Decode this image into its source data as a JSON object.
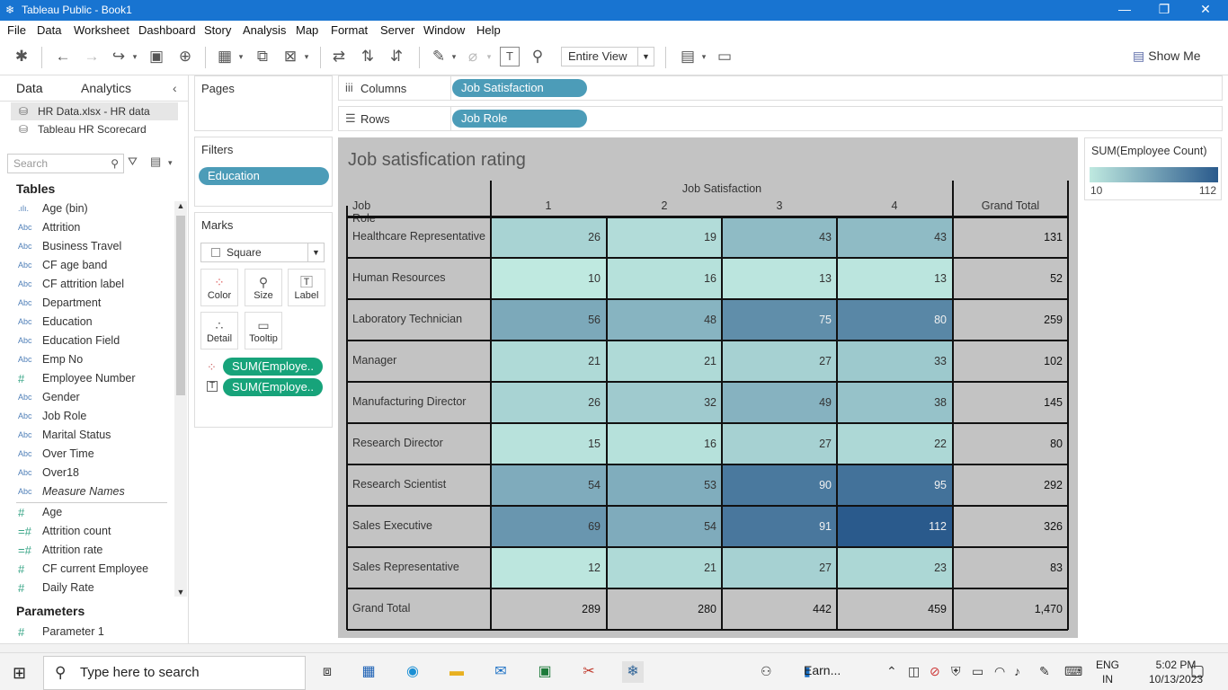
{
  "window": {
    "title": "Tableau Public - Book1",
    "minimize": "—",
    "restore": "❐",
    "close": "✕"
  },
  "menu": [
    "File",
    "Data",
    "Worksheet",
    "Dashboard",
    "Story",
    "Analysis",
    "Map",
    "Format",
    "Server",
    "Window",
    "Help"
  ],
  "toolbar": {
    "fit": "Entire View",
    "show_me": "Show Me"
  },
  "data_pane": {
    "tab_data": "Data",
    "tab_analytics": "Analytics",
    "datasources": [
      "HR Data.xlsx - HR data",
      "Tableau HR Scorecard"
    ],
    "search_placeholder": "Search",
    "tables_header": "Tables",
    "dimensions": [
      {
        "type": ".ılı.",
        "name": "Age (bin)"
      },
      {
        "type": "Abc",
        "name": "Attrition"
      },
      {
        "type": "Abc",
        "name": "Business Travel"
      },
      {
        "type": "Abc",
        "name": "CF age band"
      },
      {
        "type": "Abc",
        "name": "CF attrition label"
      },
      {
        "type": "Abc",
        "name": "Department"
      },
      {
        "type": "Abc",
        "name": "Education"
      },
      {
        "type": "Abc",
        "name": "Education Field"
      },
      {
        "type": "Abc",
        "name": "Emp No"
      },
      {
        "type": "#",
        "name": "Employee Number"
      },
      {
        "type": "Abc",
        "name": "Gender"
      },
      {
        "type": "Abc",
        "name": "Job Role"
      },
      {
        "type": "Abc",
        "name": "Marital Status"
      },
      {
        "type": "Abc",
        "name": "Over Time"
      },
      {
        "type": "Abc",
        "name": "Over18"
      },
      {
        "type": "Abc",
        "name": "Measure Names"
      }
    ],
    "measures": [
      {
        "type": "#",
        "name": "Age"
      },
      {
        "type": "=#",
        "name": "Attrition count"
      },
      {
        "type": "=#",
        "name": "Attrition rate"
      },
      {
        "type": "#",
        "name": "CF current Employee"
      },
      {
        "type": "#",
        "name": "Daily Rate"
      }
    ],
    "parameters_header": "Parameters",
    "parameters": [
      {
        "type": "#",
        "name": "Parameter 1"
      }
    ]
  },
  "pages": {
    "title": "Pages"
  },
  "filters": {
    "title": "Filters",
    "pills": [
      "Education"
    ]
  },
  "marks": {
    "title": "Marks",
    "type": "Square",
    "buttons": [
      "Color",
      "Size",
      "Label",
      "Detail",
      "Tooltip"
    ],
    "pills": [
      "SUM(Employe..",
      "SUM(Employe.."
    ]
  },
  "shelves": {
    "columns_label": "Columns",
    "columns_pill": "Job Satisfaction",
    "rows_label": "Rows",
    "rows_pill": "Job Role"
  },
  "viz": {
    "title": "Job satisfication rating",
    "row_header": "Job Role",
    "col_group_header": "Job Satisfaction",
    "grand_total_label": "Grand Total",
    "columns": [
      "1",
      "2",
      "3",
      "4"
    ]
  },
  "chart_data": {
    "type": "heatmap",
    "title": "Job satisfication rating",
    "rows": [
      "Healthcare Representative",
      "Human Resources",
      "Laboratory Technician",
      "Manager",
      "Manufacturing Director",
      "Research Director",
      "Research Scientist",
      "Sales Executive",
      "Sales Representative"
    ],
    "columns": [
      "1",
      "2",
      "3",
      "4"
    ],
    "values": [
      [
        26,
        19,
        43,
        43
      ],
      [
        10,
        16,
        13,
        13
      ],
      [
        56,
        48,
        75,
        80
      ],
      [
        21,
        21,
        27,
        33
      ],
      [
        26,
        32,
        49,
        38
      ],
      [
        15,
        16,
        27,
        22
      ],
      [
        54,
        53,
        90,
        95
      ],
      [
        69,
        54,
        91,
        112
      ],
      [
        12,
        21,
        27,
        23
      ]
    ],
    "row_totals": [
      "131",
      "52",
      "259",
      "102",
      "145",
      "80",
      "292",
      "326",
      "83"
    ],
    "column_totals": [
      "289",
      "280",
      "442",
      "459"
    ],
    "grand_total": "1,470",
    "color_min": 10,
    "color_max": 112,
    "color_low": "#bfe9e0",
    "color_high": "#2a5a8c"
  },
  "legend": {
    "title": "SUM(Employee Count)",
    "min": "10",
    "max": "112"
  },
  "taskbar": {
    "search_placeholder": "Type here to search",
    "weather": "Earn...",
    "lang1": "ENG",
    "lang2": "IN",
    "time": "5:02 PM",
    "date": "10/13/2023"
  }
}
